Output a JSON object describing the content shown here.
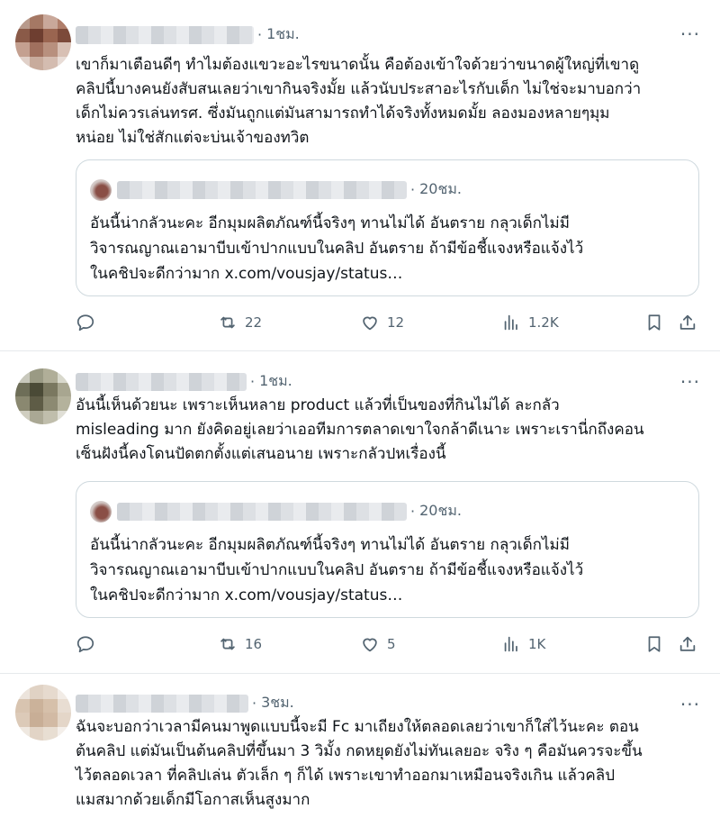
{
  "tweets": [
    {
      "time": "1ชม.",
      "more": "···",
      "text": "เขาก็มาเตือนดีๆ ทำไมต้องแขวะอะไรขนาดนั้น คือต้องเข้าใจด้วยว่าขนาดผู้ใหญ่ที่เขาดู\nคลิปนี้บางคนยังสับสนเลยว่าเขากินจริงมั้ย แล้วนับประสาอะไรกับเด็ก ไม่ใช่จะมาบอกว่า\nเด็กไม่ควรเล่นทรศ. ซึ่งมันถูกแต่มันสามารถทำได้จริงทั้งหมดมั้ย ลองมองหลายๆมุม\nหน่อย ไม่ใช่สักแต่จะบ่นเจ้าของทวิต",
      "quote": {
        "time": "20ชม.",
        "text": "อันนี้น่ากลัวนะคะ อีกมุมผลิตภัณฑ์นี้จริงๆ ทานไม่ได้ อันตราย กลุวเด็กไม่มี\nวิจารณญาณเอามาบีบเข้าปากแบบในคลิป อันตราย ถ้ามีข้อชี้แจงหรือแจ้งไว้\nในคชิปจะดีกว่ามาก x.com/vousjay/status…"
      },
      "retweets": "22",
      "likes": "12",
      "views": "1.2K"
    },
    {
      "time": "1ชม.",
      "more": "···",
      "text": "อันนี้เห็นด้วยนะ เพราะเห็นหลาย product แล้วที่เป็นของที่กินไม่ได้ ละกลัว\nmisleading มาก ยังคิดอยู่เลยว่าเออทีมการตลาดเขาใจกล้าดีเนาะ เพราะเรานี่กถึงคอน\nเซ็นฝังนี้คงโดนปัดตกตั้งแต่เสนอนาย เพราะกลัวปหเรื่องนี้",
      "quote": {
        "time": "20ชม.",
        "text": "อันนี้น่ากลัวนะคะ อีกมุมผลิตภัณฑ์นี้จริงๆ ทานไม่ได้ อันตราย กลุวเด็กไม่มี\nวิจารณญาณเอามาบีบเข้าปากแบบในคลิป อันตราย ถ้ามีข้อชี้แจงหรือแจ้งไว้\nในคชิปจะดีกว่ามาก x.com/vousjay/status…"
      },
      "retweets": "16",
      "likes": "5",
      "views": "1K"
    },
    {
      "time": "3ชม.",
      "more": "···",
      "text": "ฉันจะบอกว่าเวลามีคนมาพูดแบบนี้จะมี Fc มาเถียงให้ตลอดเลยว่าเขาก็ใส่ไว้นะคะ ตอน\nต้นคลิป แต่มันเป็นต้นคลิปที่ขึ้นมา 3 วิมั้ง กดหยุดยังไม่ทันเลยอะ จริง ๆ คือมันควรจะขึ้น\nไว้ตลอดเวลา ที่คลิปเล่น ตัวเล็ก ๆ ก็ได้ เพราะเขาทำออกมาเหมือนจริงเกิน แล้วคลิป\nแมสมากด้วยเด็กมีโอกาสเห็นสูงมาก"
    }
  ]
}
